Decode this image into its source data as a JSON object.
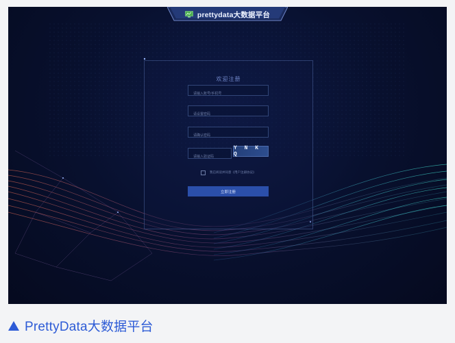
{
  "header": {
    "title": "prettydata大数据平台",
    "logo_icon": "monitor-chart-icon"
  },
  "register_form": {
    "title": "欢迎注册",
    "username_placeholder": "请输入账号/手机号",
    "password_placeholder": "请设置密码",
    "confirm_placeholder": "请确认密码",
    "captcha_placeholder": "请输入验证码",
    "captcha_code": "YNKQ",
    "agree_text": "我已阅读并同意《用户注册协议》",
    "submit_label": "立即注册"
  },
  "caption": {
    "text": "PrettyData大数据平台",
    "icon": "triangle-up-icon",
    "color": "#2d5bd6"
  },
  "colors": {
    "background": "#08102e",
    "accent": "#2b4faa"
  }
}
